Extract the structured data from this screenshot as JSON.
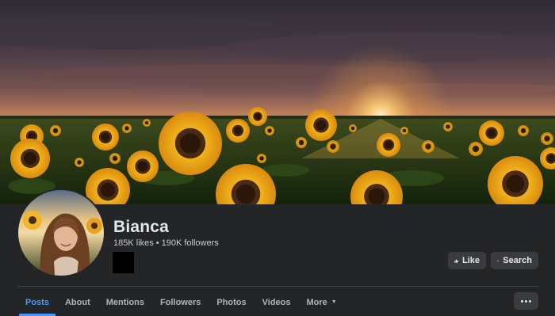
{
  "profile": {
    "name": "Bianca",
    "likes": "185K likes",
    "separator": "•",
    "followers": "190K followers"
  },
  "actions": {
    "like_label": "Like",
    "search_label": "Search"
  },
  "tabs": [
    {
      "label": "Posts",
      "active": true
    },
    {
      "label": "About"
    },
    {
      "label": "Mentions"
    },
    {
      "label": "Followers"
    },
    {
      "label": "Photos"
    },
    {
      "label": "Videos"
    },
    {
      "label": "More",
      "caret": "▼"
    }
  ],
  "colors": {
    "background": "#242526",
    "button": "#3a3b3c",
    "accent": "#4599ff",
    "text": "#e4e6eb"
  },
  "icons": {
    "like": "thumbs-up-icon",
    "search": "magnifier-icon",
    "more": "more-dots-icon"
  }
}
